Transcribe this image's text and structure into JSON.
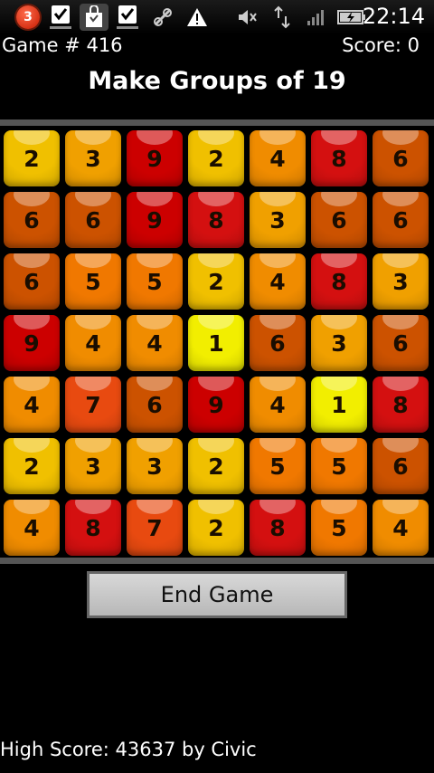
{
  "status_bar": {
    "notification_count": "3",
    "time": "22:14",
    "icons": [
      "notification-icon",
      "download-complete-icon",
      "market-bag-icon",
      "download-complete-icon",
      "usb-debug-icon",
      "warning-icon",
      "mute-icon",
      "data-transfer-icon",
      "signal-icon",
      "battery-charging-icon"
    ]
  },
  "game": {
    "game_number": "Game # 416",
    "score": "Score: 0",
    "title": "Make Groups of 19",
    "end_button": "End Game",
    "high_score": "High Score: 43637 by Civic"
  },
  "board": {
    "rows": [
      [
        "2",
        "3",
        "9",
        "2",
        "4",
        "8",
        "6"
      ],
      [
        "6",
        "6",
        "9",
        "8",
        "3",
        "6",
        "6"
      ],
      [
        "6",
        "5",
        "5",
        "2",
        "4",
        "8",
        "3"
      ],
      [
        "9",
        "4",
        "4",
        "1",
        "6",
        "3",
        "6"
      ],
      [
        "4",
        "7",
        "6",
        "9",
        "4",
        "1",
        "8"
      ],
      [
        "2",
        "3",
        "3",
        "2",
        "5",
        "5",
        "6"
      ],
      [
        "4",
        "8",
        "7",
        "2",
        "8",
        "5",
        "4"
      ]
    ],
    "tile_colors": {
      "1": "#f2ee00",
      "2": "#f0c000",
      "3": "#f0a000",
      "4": "#f08c00",
      "5": "#f07800",
      "6": "#cc5200",
      "7": "#e84a10",
      "8": "#d41010",
      "9": "#cc0000"
    }
  }
}
